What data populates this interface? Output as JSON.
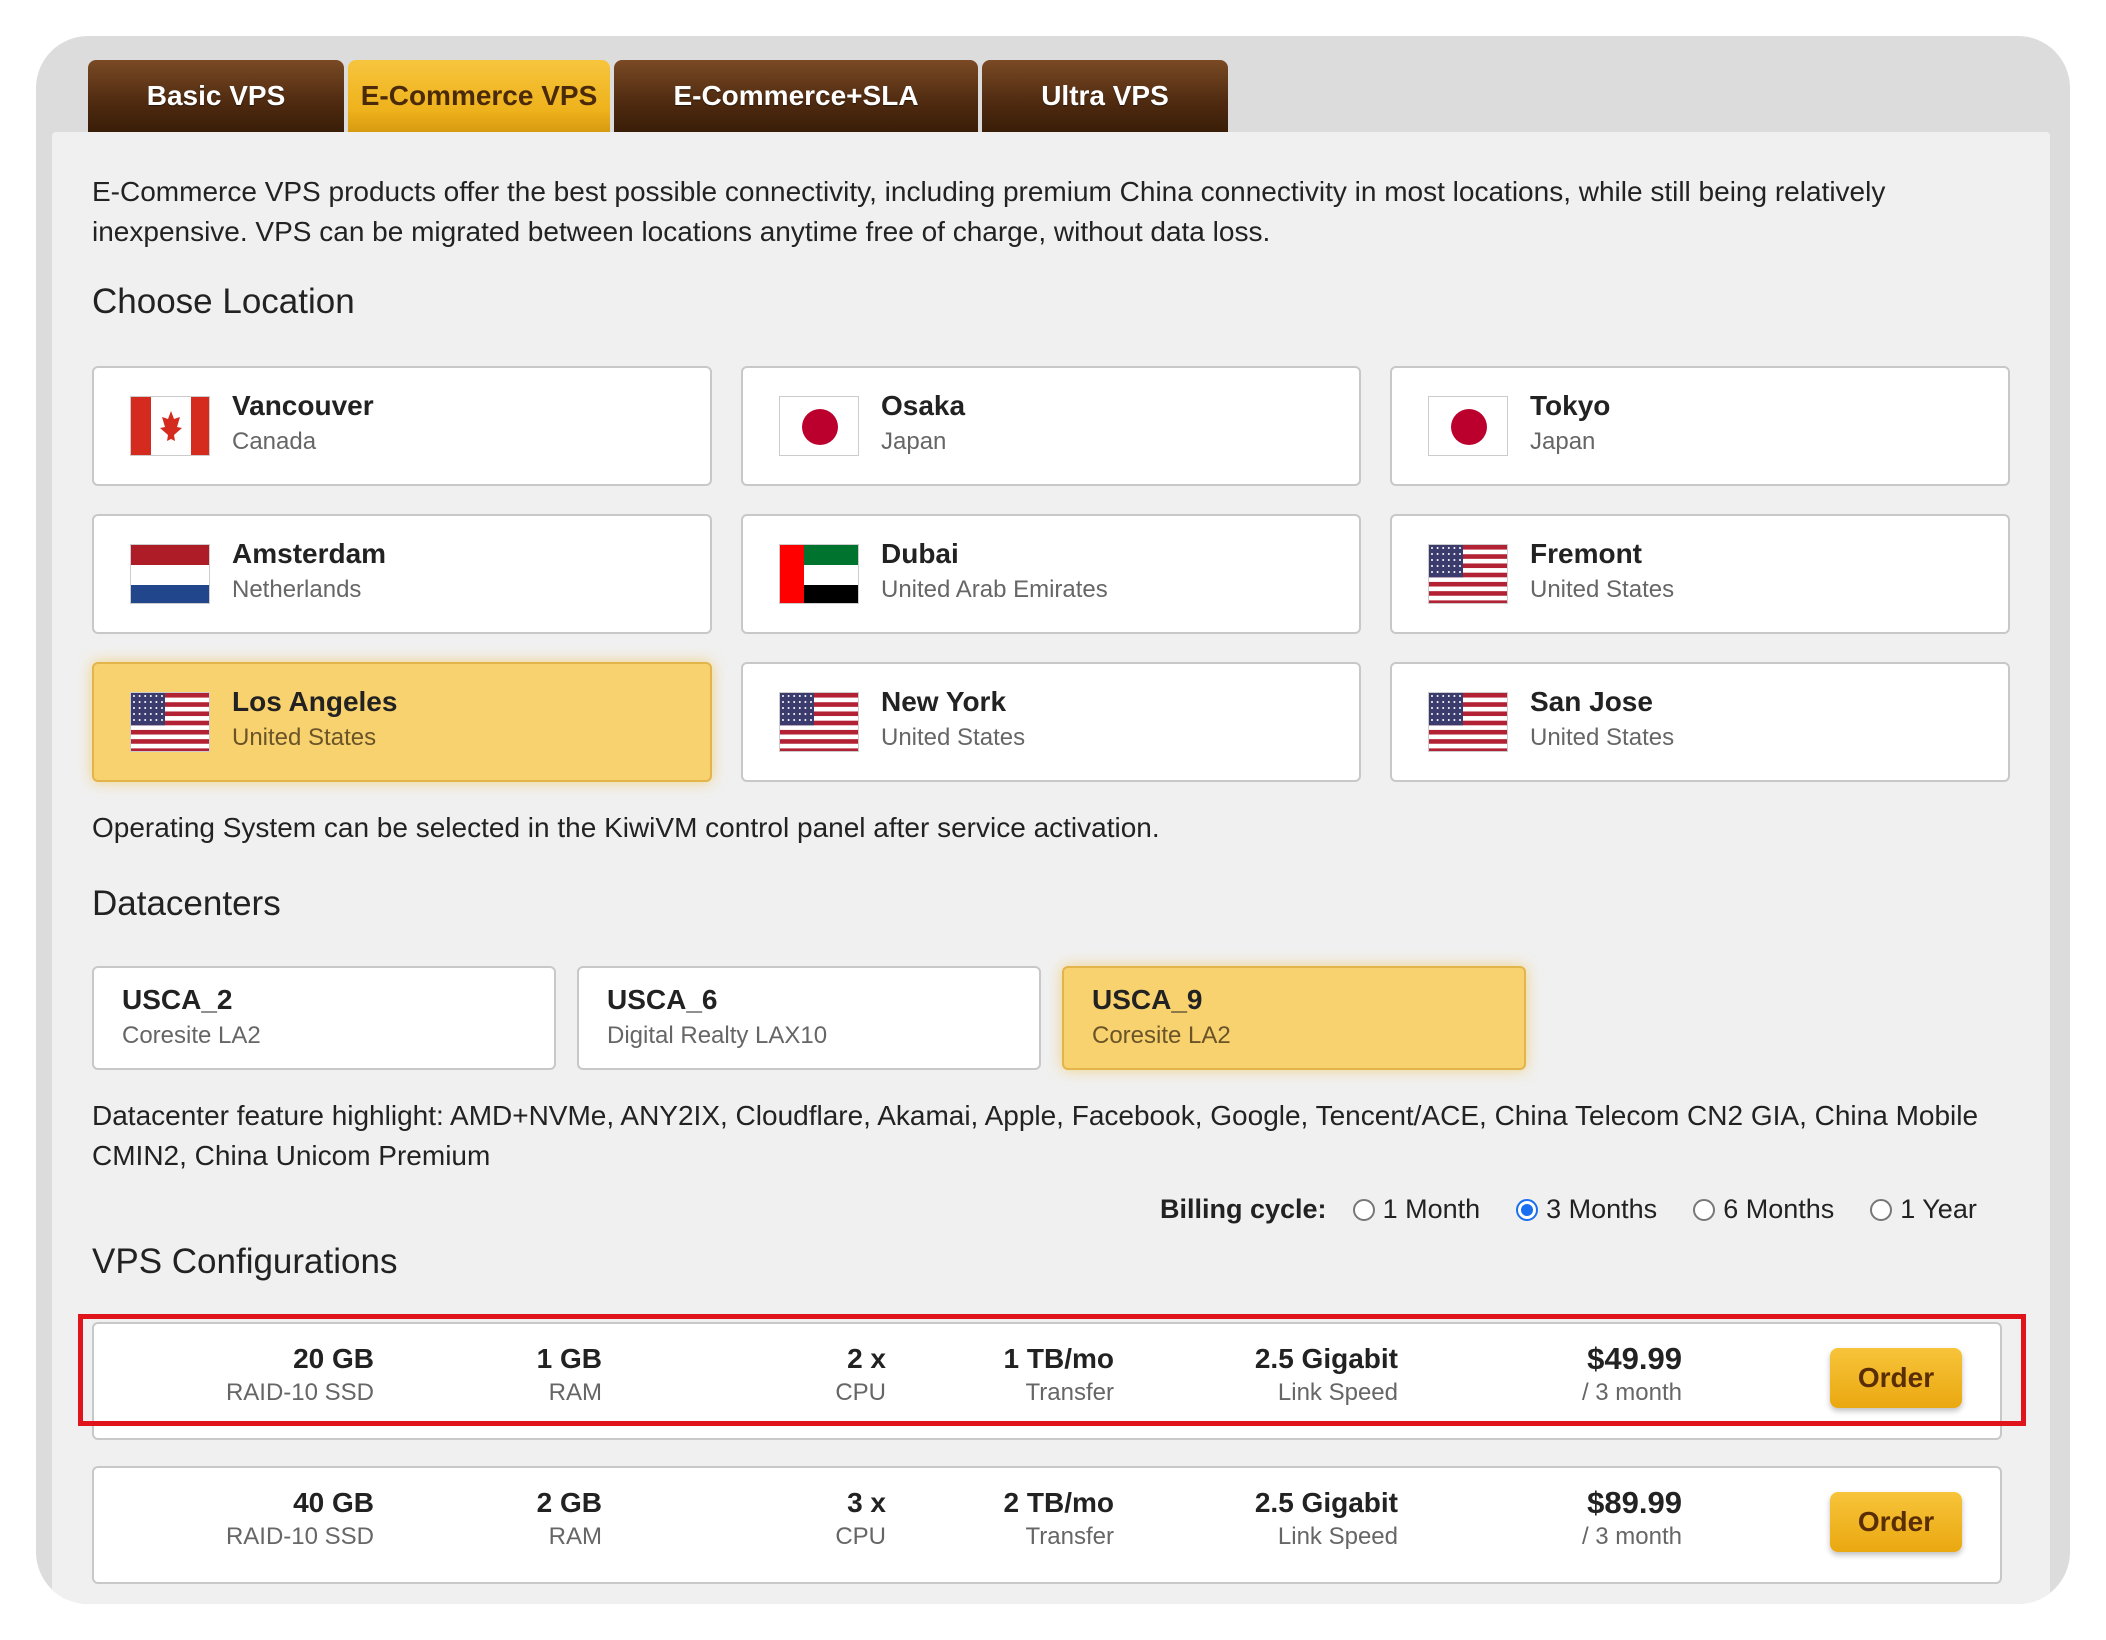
{
  "tabs": [
    {
      "label": "Basic VPS"
    },
    {
      "label": "E-Commerce VPS"
    },
    {
      "label": "E-Commerce+SLA"
    },
    {
      "label": "Ultra VPS"
    }
  ],
  "intro": "E-Commerce VPS products offer the best possible connectivity, including premium China connectivity in most locations, while still being relatively inexpensive. VPS can be migrated between locations anytime free of charge, without data loss.",
  "location": {
    "heading": "Choose Location",
    "items": [
      {
        "city": "Vancouver",
        "country": "Canada",
        "flag": "flag-canada"
      },
      {
        "city": "Osaka",
        "country": "Japan",
        "flag": "flag-japan"
      },
      {
        "city": "Tokyo",
        "country": "Japan",
        "flag": "flag-japan"
      },
      {
        "city": "Amsterdam",
        "country": "Netherlands",
        "flag": "flag-netherlands"
      },
      {
        "city": "Dubai",
        "country": "United Arab Emirates",
        "flag": "flag-uae"
      },
      {
        "city": "Fremont",
        "country": "United States",
        "flag": "flag-usa"
      },
      {
        "city": "Los Angeles",
        "country": "United States",
        "flag": "flag-usa",
        "selected": true
      },
      {
        "city": "New York",
        "country": "United States",
        "flag": "flag-usa"
      },
      {
        "city": "San Jose",
        "country": "United States",
        "flag": "flag-usa"
      }
    ]
  },
  "os_note": "Operating System can be selected in the KiwiVM control panel after service activation.",
  "datacenters": {
    "heading": "Datacenters",
    "items": [
      {
        "name": "USCA_2",
        "facility": "Coresite LA2"
      },
      {
        "name": "USCA_6",
        "facility": "Digital Realty LAX10"
      },
      {
        "name": "USCA_9",
        "facility": "Coresite LA2",
        "selected": true
      }
    ],
    "feature_note": "Datacenter feature highlight: AMD+NVMe, ANY2IX, Cloudflare, Akamai, Apple, Facebook, Google, Tencent/ACE, China Telecom CN2 GIA, China Mobile CMIN2, China Unicom Premium"
  },
  "configs": {
    "heading": "VPS Configurations",
    "billing_label": "Billing cycle:",
    "billing_options": [
      {
        "label": "1 Month",
        "checked": false
      },
      {
        "label": "3 Months",
        "checked": true
      },
      {
        "label": "6 Months",
        "checked": false
      },
      {
        "label": "1 Year",
        "checked": false
      }
    ],
    "plans": [
      {
        "disk": "20 GB",
        "disk_label": "RAID-10 SSD",
        "ram": "1 GB",
        "ram_label": "RAM",
        "cpu": "2 x",
        "cpu_label": "CPU",
        "transfer": "1 TB/mo",
        "transfer_label": "Transfer",
        "speed": "2.5 Gigabit",
        "speed_label": "Link Speed",
        "price": "$49.99",
        "period": "/ 3 month",
        "order_label": "Order"
      },
      {
        "disk": "40 GB",
        "disk_label": "RAID-10 SSD",
        "ram": "2 GB",
        "ram_label": "RAM",
        "cpu": "3 x",
        "cpu_label": "CPU",
        "transfer": "2 TB/mo",
        "transfer_label": "Transfer",
        "speed": "2.5 Gigabit",
        "speed_label": "Link Speed",
        "price": "$89.99",
        "period": "/ 3 month",
        "order_label": "Order"
      }
    ]
  },
  "colors": {
    "selected_bg": "#f8d26e",
    "tab_active": "#f2b928",
    "tab_inactive": "#5a3214",
    "highlight_border": "#e0141b",
    "radio_checked": "#1a6ef0"
  }
}
